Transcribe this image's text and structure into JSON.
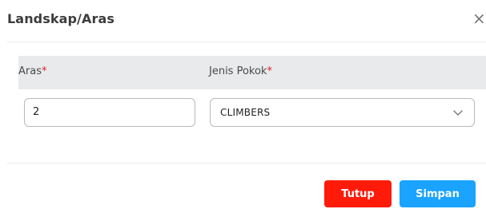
{
  "modal": {
    "title": "Landskap/Aras",
    "close_symbol": "×"
  },
  "table": {
    "columns": [
      {
        "label": "Aras",
        "required_mark": "*"
      },
      {
        "label": "Jenis Pokok",
        "required_mark": "*"
      }
    ],
    "row": {
      "aras_value": "2",
      "jenis_pokok_value": "CLIMBERS"
    }
  },
  "footer": {
    "close_label": "Tutup",
    "save_label": "Simpan"
  },
  "colors": {
    "close_button": "#ff1a0a",
    "save_button": "#1aa3ff",
    "required_asterisk": "#e02020",
    "header_background": "#e9eaec"
  },
  "icons": {
    "close": "close-icon",
    "dropdown": "chevron-down-icon"
  }
}
